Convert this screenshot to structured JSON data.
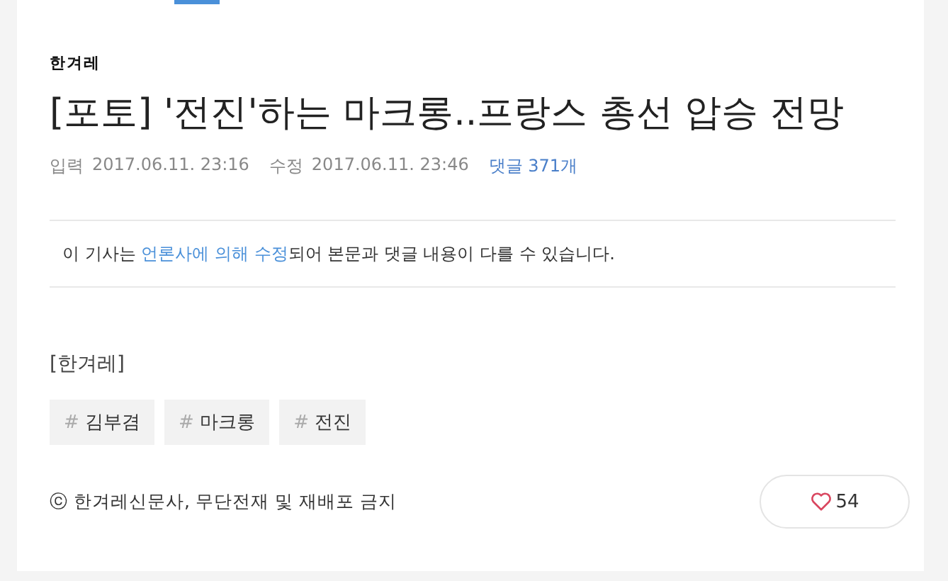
{
  "publisher": "한겨레",
  "title": "[포토] '전진'하는 마크롱..프랑스 총선 압승 전망",
  "meta": {
    "input_label": "입력",
    "input_time": "2017.06.11. 23:16",
    "edit_label": "수정",
    "edit_time": "2017.06.11. 23:46",
    "comments": "댓글 371개"
  },
  "notice": {
    "before": "이 기사는 ",
    "link": "언론사에 의해 수정",
    "after": "되어 본문과 댓글 내용이 다를 수 있습니다."
  },
  "body": "[한겨레]",
  "tags": [
    {
      "hash": "#",
      "label": "김부겸"
    },
    {
      "hash": "#",
      "label": "마크롱"
    },
    {
      "hash": "#",
      "label": "전진"
    }
  ],
  "copyright": "ⓒ 한겨레신문사, 무단전재 및 재배포 금지",
  "likes": "54"
}
